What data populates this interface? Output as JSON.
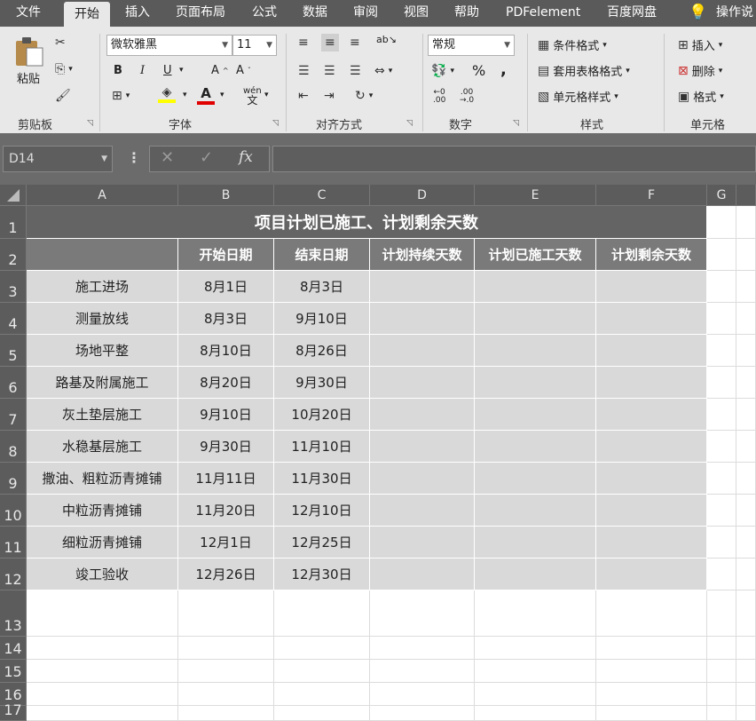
{
  "menu": {
    "tabs": [
      "文件",
      "开始",
      "插入",
      "页面布局",
      "公式",
      "数据",
      "审阅",
      "视图",
      "帮助",
      "PDFelement",
      "百度网盘",
      "操作说"
    ]
  },
  "ribbon": {
    "clipboard": {
      "paste": "粘贴",
      "group": "剪贴板"
    },
    "font": {
      "name": "微软雅黑",
      "size": "11",
      "group": "字体",
      "bold": "B",
      "italic": "I",
      "underline": "U",
      "wen": "wén\n文"
    },
    "align": {
      "group": "对齐方式"
    },
    "number": {
      "format": "常规",
      "percent": "%",
      "comma": ",",
      "group": "数字"
    },
    "styles": {
      "conditional": "条件格式",
      "table": "套用表格格式",
      "cell": "单元格样式",
      "group": "样式"
    },
    "cells": {
      "insert": "插入",
      "delete": "删除",
      "format": "格式",
      "group": "单元格"
    }
  },
  "formula_bar": {
    "name_box": "D14",
    "value": ""
  },
  "columns": [
    "A",
    "B",
    "C",
    "D",
    "E",
    "F",
    "G"
  ],
  "rows": [
    "1",
    "2",
    "3",
    "4",
    "5",
    "6",
    "7",
    "8",
    "9",
    "10",
    "11",
    "12",
    "13",
    "14",
    "15",
    "16",
    "17"
  ],
  "sheet": {
    "title": "项目计划已施工、计划剩余天数",
    "headers": [
      "",
      "开始日期",
      "结束日期",
      "计划持续天数",
      "计划已施工天数",
      "计划剩余天数"
    ],
    "data": [
      [
        "施工进场",
        "8月1日",
        "8月3日"
      ],
      [
        "测量放线",
        "8月3日",
        "9月10日"
      ],
      [
        "场地平整",
        "8月10日",
        "8月26日"
      ],
      [
        "路基及附属施工",
        "8月20日",
        "9月30日"
      ],
      [
        "灰土垫层施工",
        "9月10日",
        "10月20日"
      ],
      [
        "水稳基层施工",
        "9月30日",
        "11月10日"
      ],
      [
        "撒油、粗粒沥青摊铺",
        "11月11日",
        "11月30日"
      ],
      [
        "中粒沥青摊铺",
        "11月20日",
        "12月10日"
      ],
      [
        "细粒沥青摊铺",
        "12月1日",
        "12月25日"
      ],
      [
        "竣工验收",
        "12月26日",
        "12月30日"
      ]
    ]
  }
}
